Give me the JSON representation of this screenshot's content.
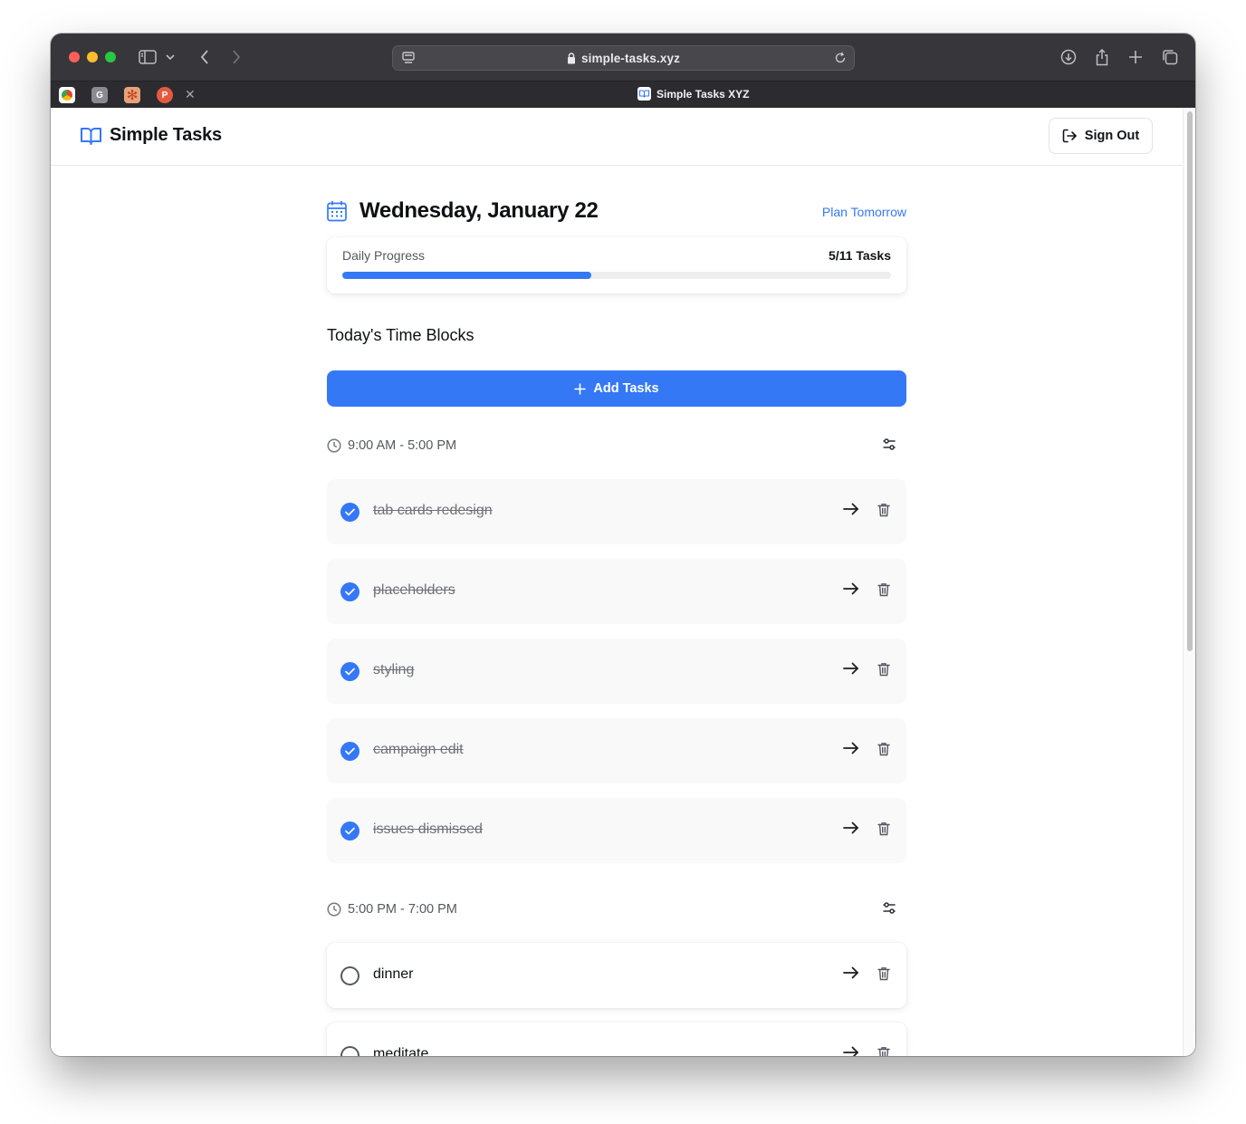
{
  "browser": {
    "url": "simple-tasks.xyz",
    "active_tab_title": "Simple Tasks XYZ",
    "pinned_tabs": [
      {
        "icon": "chrome-icon",
        "label": ""
      },
      {
        "icon": "g-letter-icon",
        "label": "G"
      },
      {
        "icon": "asterisk-icon",
        "label": ""
      },
      {
        "icon": "p-letter-icon",
        "label": "P"
      }
    ]
  },
  "header": {
    "app_name": "Simple Tasks",
    "sign_out_label": "Sign Out"
  },
  "day": {
    "date_title": "Wednesday, January 22",
    "plan_tomorrow_label": "Plan Tomorrow"
  },
  "progress": {
    "label": "Daily Progress",
    "count_text": "5/11 Tasks",
    "completed": 5,
    "total": 11
  },
  "section": {
    "title": "Today's Time Blocks",
    "add_tasks_label": "Add Tasks"
  },
  "blocks": [
    {
      "range": "9:00 AM - 5:00 PM",
      "tasks": [
        {
          "text": "tab cards redesign",
          "done": true
        },
        {
          "text": "placeholders",
          "done": true
        },
        {
          "text": "styling",
          "done": true
        },
        {
          "text": "campaign edit",
          "done": true
        },
        {
          "text": "issues dismissed",
          "done": true
        }
      ]
    },
    {
      "range": "5:00 PM - 7:00 PM",
      "tasks": [
        {
          "text": "dinner",
          "done": false
        },
        {
          "text": "meditate",
          "done": false
        }
      ]
    }
  ],
  "colors": {
    "accent": "#3478f6",
    "chrome_bg": "#37363b",
    "done_task_bg": "#f9f9fa"
  }
}
